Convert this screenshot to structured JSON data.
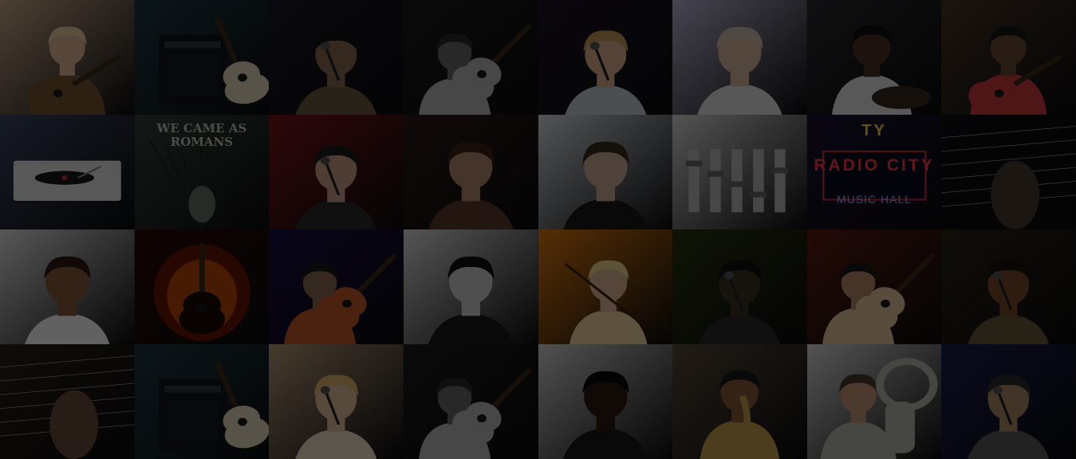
{
  "mosaic": {
    "columns": 8,
    "rows": 4,
    "overlay_color": "#000000",
    "tiles": [
      {
        "kind": "portrait-guitar",
        "bg": "#c9a98a",
        "fg": "#7a5232",
        "skin": "#e2bc98",
        "hair": "#e9cf9a"
      },
      {
        "kind": "amp-guitar",
        "bg": "#1e3a45",
        "fg": "#e8d9bf"
      },
      {
        "kind": "portrait-mic",
        "bg": "#1a1726",
        "fg": "#6a5a40",
        "skin": "#8a6a52",
        "hair": "#111111"
      },
      {
        "kind": "guitarist-dark",
        "bg": "#1c1c1e",
        "fg": "#bbbbbb",
        "skin": "#6a6a6a",
        "hair": "#2a2a2a"
      },
      {
        "kind": "portrait-mic",
        "bg": "#1a1424",
        "fg": "#c6cfd6",
        "skin": "#dcb08e",
        "hair": "#c89c5c"
      },
      {
        "kind": "portrait",
        "bg": "#b9b6d2",
        "fg": "#e4e4e4",
        "skin": "#d8b8a0",
        "hair": "#d0c0b0"
      },
      {
        "kind": "portrait-drum",
        "bg": "#2a2a2e",
        "fg": "#e8e8e8",
        "skin": "#4a3428",
        "hair": "#111111"
      },
      {
        "kind": "portrait-guitar",
        "bg": "#4a3426",
        "fg": "#cc3a3a",
        "skin": "#6a4a38",
        "hair": "#1a1a1a"
      },
      {
        "kind": "turntable",
        "bg": "#3b4660",
        "fg": "#e8e8ea"
      },
      {
        "kind": "album-text",
        "bg": "#3a3f3c",
        "fg": "#c9c9c0",
        "caption": "WE CAME AS ROMANS"
      },
      {
        "kind": "portrait-mic",
        "bg": "#7a1418",
        "fg": "#2a2a2a",
        "skin": "#caa08c",
        "hair": "#1c1c1c"
      },
      {
        "kind": "portrait",
        "bg": "#2a1a16",
        "fg": "#5c3a2a",
        "skin": "#b48a70",
        "hair": "#3a2418"
      },
      {
        "kind": "portrait",
        "bg": "#d8dce2",
        "fg": "#1a1a1a",
        "skin": "#ccae98",
        "hair": "#3c2a1e"
      },
      {
        "kind": "mixer",
        "bg": "#dcdcde",
        "fg": "#6a6a6a"
      },
      {
        "kind": "marquee",
        "bg": "#1a1230",
        "fg": "#3a7cff",
        "caption": "RADIO CITY",
        "subcaption": "MUSIC HALL",
        "topcaption": "TY"
      },
      {
        "kind": "fretboard",
        "bg": "#0e0e10",
        "fg": "#4a3a30"
      },
      {
        "kind": "portrait",
        "bg": "#e6e6e8",
        "fg": "#ffffff",
        "skin": "#8a5a3c",
        "hair": "#2a1a10"
      },
      {
        "kind": "fire-guitar",
        "bg": "#2a0a04",
        "fg": "#ff6a10"
      },
      {
        "kind": "guitarist-dark",
        "bg": "#1a0f45",
        "fg": "#c45a2a",
        "skin": "#8a6a52",
        "hair": "#1a1a1a"
      },
      {
        "kind": "portrait",
        "bg": "#e0e0e0",
        "fg": "#1a1a1a",
        "skin": "#cfcfcf",
        "hair": "#111111"
      },
      {
        "kind": "violinist",
        "bg": "#e07a10",
        "fg": "#f2d8a0",
        "skin": "#e2b896",
        "hair": "#f0d890"
      },
      {
        "kind": "portrait-mic",
        "bg": "#2a3410",
        "fg": "#2a2a2a",
        "skin": "#3a3020",
        "hair": "#111111"
      },
      {
        "kind": "guitarist-dark",
        "bg": "#5a1c10",
        "fg": "#e8c8a0",
        "skin": "#b88a6c",
        "hair": "#1a1a1a"
      },
      {
        "kind": "portrait-mic",
        "bg": "#2a2416",
        "fg": "#6a5a3a",
        "skin": "#7a4a2c",
        "hair": "#1a1208"
      },
      {
        "kind": "fretboard",
        "bg": "#2a1f1a",
        "fg": "#6a4a3a"
      },
      {
        "kind": "amp-guitar",
        "bg": "#1e3a45",
        "fg": "#e8d9bf"
      },
      {
        "kind": "portrait-mic",
        "bg": "#b89a7a",
        "fg": "#f0e0c8",
        "skin": "#e8c0a0",
        "hair": "#e0b870"
      },
      {
        "kind": "guitarist-dark",
        "bg": "#1c1c1e",
        "fg": "#bbbbbb",
        "skin": "#6a6a6a",
        "hair": "#2a2a2a"
      },
      {
        "kind": "portrait",
        "bg": "#d6d6d6",
        "fg": "#1a1a1a",
        "skin": "#2a1a12",
        "hair": "#0a0a0a"
      },
      {
        "kind": "sax",
        "bg": "#5a4a3a",
        "fg": "#c8a050",
        "skin": "#8a5a3a",
        "hair": "#1a1a1a"
      },
      {
        "kind": "tuba",
        "bg": "#dcdcdc",
        "fg": "#b8b8b0",
        "skin": "#c89a7a",
        "hair": "#4a3a2a"
      },
      {
        "kind": "portrait-mic",
        "bg": "#1a2050",
        "fg": "#5a5a5a",
        "skin": "#b08a6a",
        "hair": "#2a2a2a"
      }
    ]
  }
}
